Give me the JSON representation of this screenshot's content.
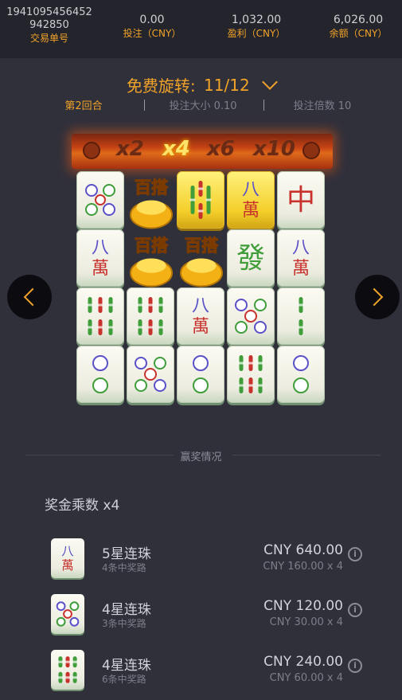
{
  "header": {
    "transaction_id_line1": "1941095456452",
    "transaction_id_line2": "942850",
    "transaction_label": "交易单号",
    "bet_value": "0.00",
    "bet_label": "投注（CNY）",
    "profit_value": "1,032.00",
    "profit_label": "盈利（CNY）",
    "balance_value": "6,026.00",
    "balance_label": "余额（CNY）"
  },
  "free_spins": {
    "label": "免费旋转:",
    "count": "11/12"
  },
  "round_info": {
    "round": "第2回合",
    "bet_size": "投注大小 0.10",
    "bet_multiplier": "投注倍数 10"
  },
  "multipliers": {
    "items": [
      "x2",
      "x4",
      "x6",
      "x10"
    ],
    "active": "x4"
  },
  "board": {
    "tiles": [
      [
        "four-circles",
        "wild",
        "three-bamboo-gold",
        "eight-wan-gold",
        "red-dragon"
      ],
      [
        "eight-wan",
        "wild",
        "wild",
        "green-dragon",
        "eight-wan"
      ],
      [
        "four-bamboo",
        "four-bamboo",
        "eight-wan",
        "five-circles",
        "two-bamboo"
      ],
      [
        "two-circles",
        "five-circles",
        "two-circles",
        "five-bamboo",
        "two-circles"
      ]
    ],
    "wild_label": "百搭"
  },
  "nav": {
    "prev_icon": "chevron-left-icon",
    "next_icon": "chevron-right-icon"
  },
  "winnings": {
    "title": "赢奖情况",
    "multiplier_text": "奖金乘数 x4",
    "rows": [
      {
        "symbol": "eight-wan",
        "name": "5星连珠",
        "ways": "4条中奖路",
        "amount": "CNY 640.00",
        "calc": "CNY 160.00 x 4"
      },
      {
        "symbol": "five-circles",
        "name": "4星连珠",
        "ways": "3条中奖路",
        "amount": "CNY 120.00",
        "calc": "CNY 30.00 x 4"
      },
      {
        "symbol": "four-bamboo",
        "name": "4星连珠",
        "ways": "6条中奖路",
        "amount": "CNY 240.00",
        "calc": "CNY 60.00 x 4"
      }
    ],
    "info_icon": "i"
  },
  "colors": {
    "accent": "#f0a328",
    "background": "#30303b",
    "header_bg": "#24242d"
  }
}
